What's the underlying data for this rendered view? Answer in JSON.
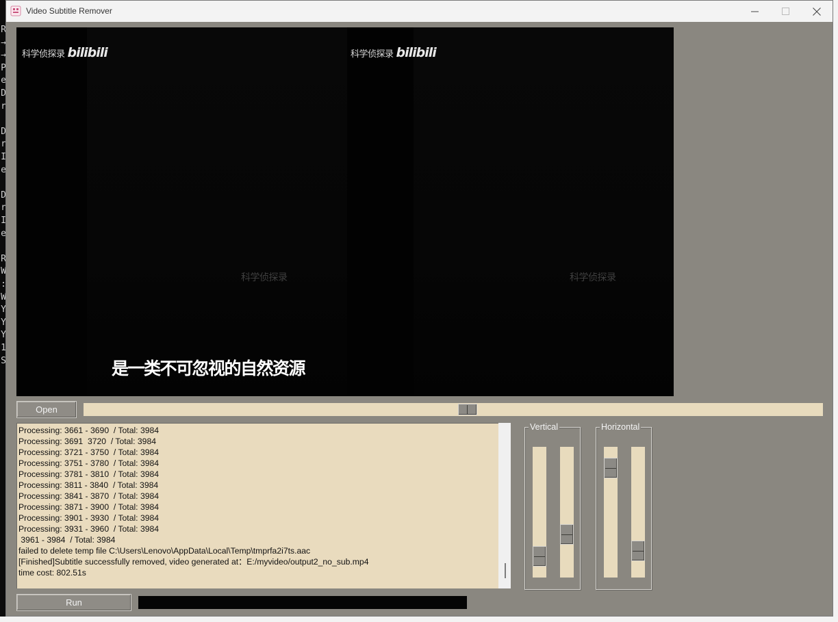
{
  "window": {
    "title": "Video Subtitle Remover",
    "controls": [
      "minimize-icon",
      "maximize-icon",
      "close-icon"
    ]
  },
  "terminal_chars": [
    "R",
    "→",
    "→",
    "P",
    "e",
    "D",
    "r",
    "",
    "D",
    "r",
    "I",
    "e",
    "",
    "D",
    "r",
    "I",
    "e",
    "",
    "R",
    "W",
    ":",
    "W",
    "Y",
    "Y",
    "Y",
    "1",
    "S"
  ],
  "video": {
    "logo_text": "科学侦探录",
    "logo_brand": "bilibili",
    "watermark_text": "科学侦探录",
    "subtitle_text": "是一类不可忽视的自然资源"
  },
  "controls": {
    "open_label": "Open",
    "run_label": "Run",
    "seek_position": 0.52,
    "progress_fraction": 0.0
  },
  "log": {
    "lines": [
      "Processing: 3661 - 3690  / Total: 3984",
      "Processing: 3691  3720  / Total: 3984",
      "Processing: 3721 - 3750  / Total: 3984",
      "Processing: 3751 - 3780  / Total: 3984",
      "Processing: 3781 - 3810  / Total: 3984",
      "Processing: 3811 - 3840  / Total: 3984",
      "Processing: 3841 - 3870  / Total: 3984",
      "Processing: 3871 - 3900  / Total: 3984",
      "Processing: 3901 - 3930  / Total: 3984",
      "Processing: 3931 - 3960  / Total: 3984",
      " 3961 - 3984  / Total: 3984",
      "failed to delete temp file C:\\Users\\Lenovo\\AppData\\Local\\Temp\\tmprfa2i7ts.aac",
      "[Finished]Subtitle successfully removed, video generated at：E:/myvideo/output2_no_sub.mp4",
      "time cost: 802.51s"
    ]
  },
  "sliders": {
    "vertical": {
      "label": "Vertical",
      "values": [
        0.1,
        0.3
      ]
    },
    "horizontal": {
      "label": "Horizontal",
      "values": [
        0.9,
        0.15
      ]
    }
  },
  "colors": {
    "window_bg": "#8a8780",
    "panel_beige": "#e8dbbd",
    "video_bg": "#020202"
  }
}
